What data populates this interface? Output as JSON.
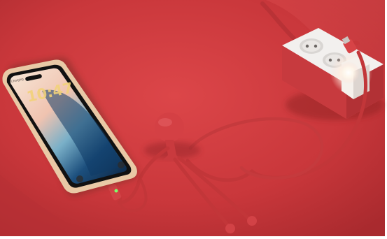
{
  "scene": {
    "background_color": "#cf3b3f",
    "accent_color": "#d94448",
    "cable_color": "#c8383b",
    "socket_color": "#ffffff"
  },
  "phone": {
    "status_carrier": "Charging",
    "lock_time": "10:47"
  }
}
